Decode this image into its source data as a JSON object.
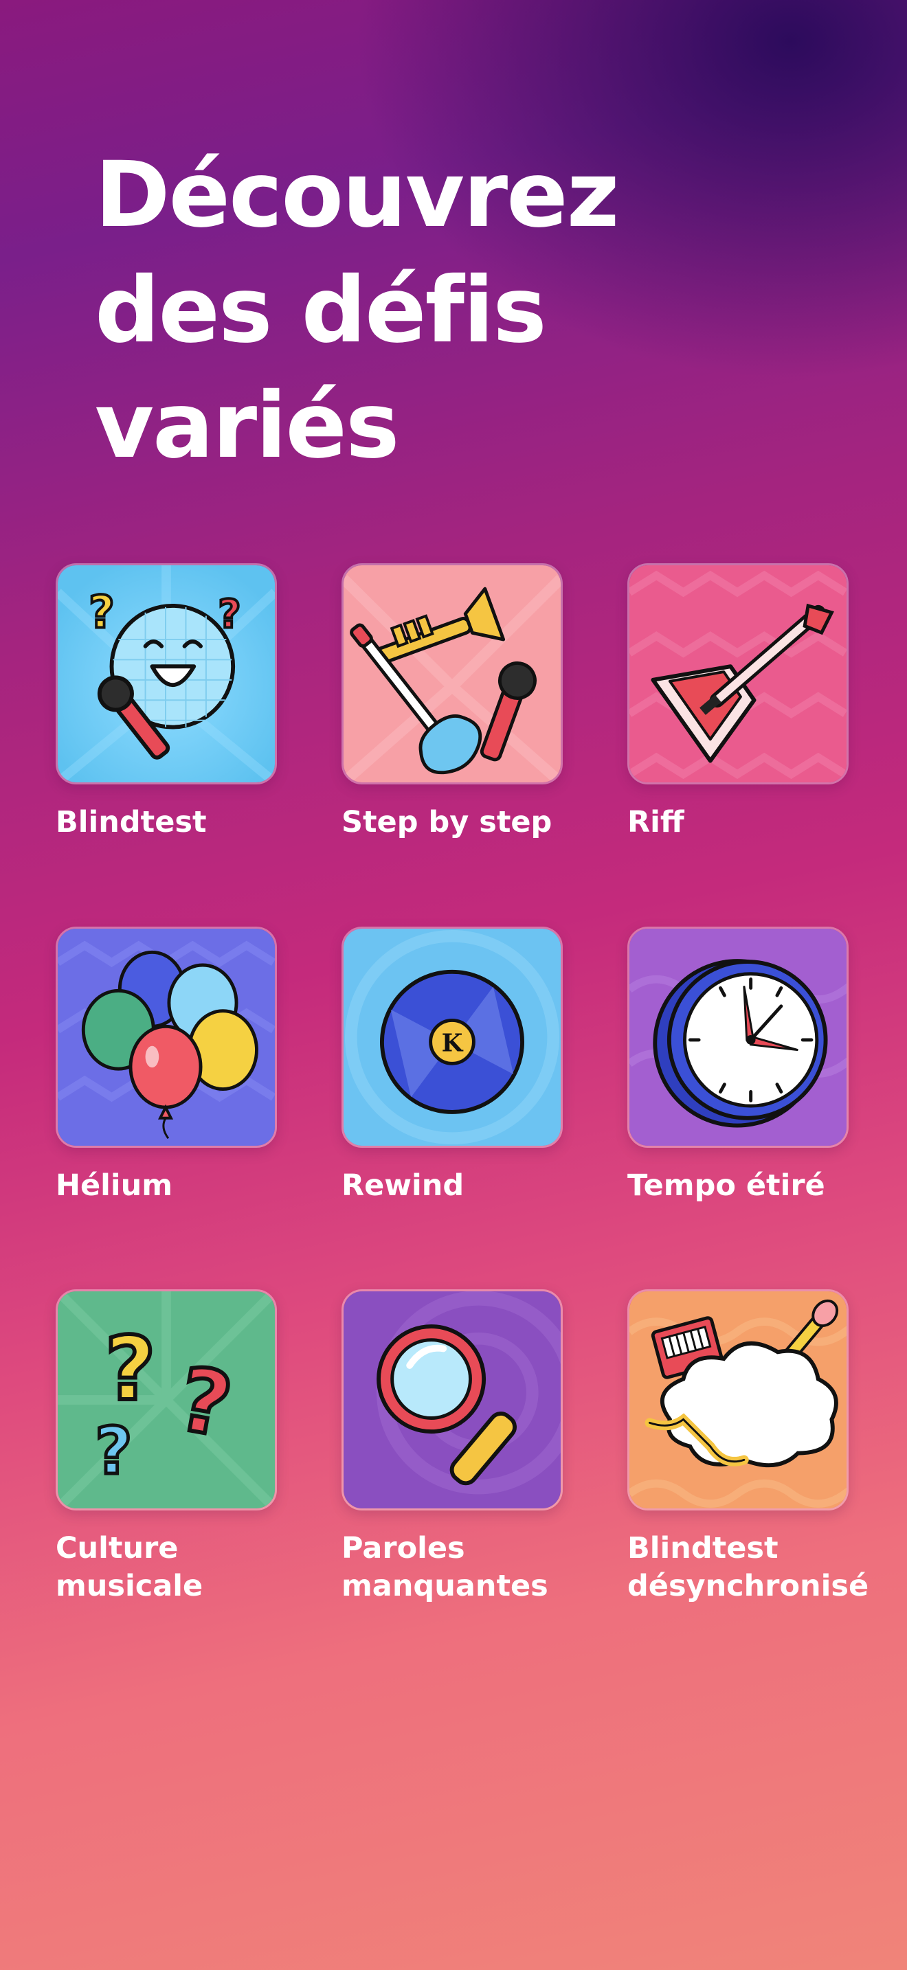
{
  "headline": {
    "line1": "Découvrez",
    "line2": "des défis variés"
  },
  "modes": [
    {
      "label_lines": [
        "Blindtest"
      ],
      "icon": "microphone-disco-ball-icon",
      "bg": "#6ecbf3"
    },
    {
      "label_lines": [
        "Step by step"
      ],
      "icon": "instruments-icon",
      "bg": "#f7a0a6"
    },
    {
      "label_lines": [
        "Riff"
      ],
      "icon": "electric-guitar-icon",
      "bg": "#ea5b8e"
    },
    {
      "label_lines": [
        "Hélium"
      ],
      "icon": "balloons-icon",
      "bg": "#6c6ee6"
    },
    {
      "label_lines": [
        "Rewind"
      ],
      "icon": "vinyl-record-icon",
      "bg": "#6cc3f2"
    },
    {
      "label_lines": [
        "Tempo étiré"
      ],
      "icon": "clock-icon",
      "bg": "#a35fd0"
    },
    {
      "label_lines": [
        "Culture",
        "musicale"
      ],
      "icon": "question-marks-icon",
      "bg": "#5fb98c"
    },
    {
      "label_lines": [
        "Paroles",
        "manquantes"
      ],
      "icon": "magnifying-glass-icon",
      "bg": "#8a4fc0"
    },
    {
      "label_lines": [
        "Blindtest",
        "désynchronisé"
      ],
      "icon": "instrument-cloud-icon",
      "bg": "#f5a06a"
    }
  ]
}
